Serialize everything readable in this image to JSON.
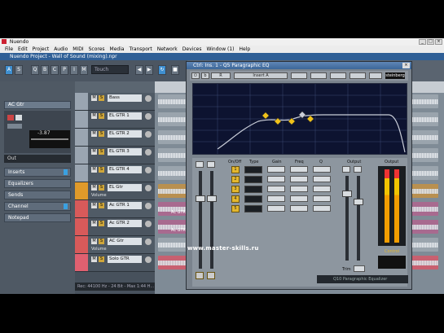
{
  "app": {
    "title": "Nuendo"
  },
  "menu": [
    "File",
    "Edit",
    "Project",
    "Audio",
    "MIDI",
    "Scores",
    "Media",
    "Transport",
    "Network",
    "Devices",
    "Window (1)",
    "Help"
  ],
  "project": {
    "title": "Nuendo Project - Wall of Sound (mixing).npr"
  },
  "toolbar": {
    "touch_mode": "Touch",
    "buttons": [
      "A",
      "S",
      "Q",
      "B",
      "C",
      "P",
      "I",
      "M",
      "R",
      "W"
    ]
  },
  "inspector": {
    "track_name": "AC Gtr",
    "volume_value": "-3.87",
    "output": "Out",
    "sections": [
      "Inserts",
      "Equalizers",
      "Sends",
      "Channel",
      "Notepad"
    ]
  },
  "tracks": [
    {
      "name": "Bass",
      "sub": "",
      "color": "#9aa5b1"
    },
    {
      "name": "EL GTR 1",
      "sub": "",
      "color": "#9aa5b1"
    },
    {
      "name": "EL GTR 2",
      "sub": "",
      "color": "#9aa5b1"
    },
    {
      "name": "EL GTR 3",
      "sub": "",
      "color": "#9aa5b1"
    },
    {
      "name": "EL GTR 4",
      "sub": "",
      "color": "#9aa5b1"
    },
    {
      "name": "EL Gtr",
      "sub": "Volume",
      "color": "#e09a2a"
    },
    {
      "name": "Ac GTR 1",
      "sub": "",
      "color": "#d85a5a"
    },
    {
      "name": "Ac GTR 2",
      "sub": "",
      "color": "#d85a5a"
    },
    {
      "name": "AC Gtr",
      "sub": "Volume",
      "color": "#d85a5a"
    },
    {
      "name": "Solo GTR",
      "sub": "",
      "color": "#e06070"
    }
  ],
  "parts": [
    "Ac GTR 1",
    "Ac GTR 2"
  ],
  "status": {
    "text": "Rec: 44100 Hz - 24 Bit - Max 1:44 H..."
  },
  "eq": {
    "title": "Ctrl: Ins. 1 - Q5 Paragraphic EQ",
    "preset": "Insert A",
    "brand": "steinberg",
    "band_labels": [
      "On/Off",
      "Type",
      "Gain",
      "Freq",
      "Q"
    ],
    "labels": {
      "input": "INPUT",
      "output": "Output",
      "control": "Control",
      "low": "Low",
      "trim": "Trim"
    },
    "footer": "Q10 Paragraphic Equalizer"
  },
  "watermark": "www.master-skills.ru"
}
